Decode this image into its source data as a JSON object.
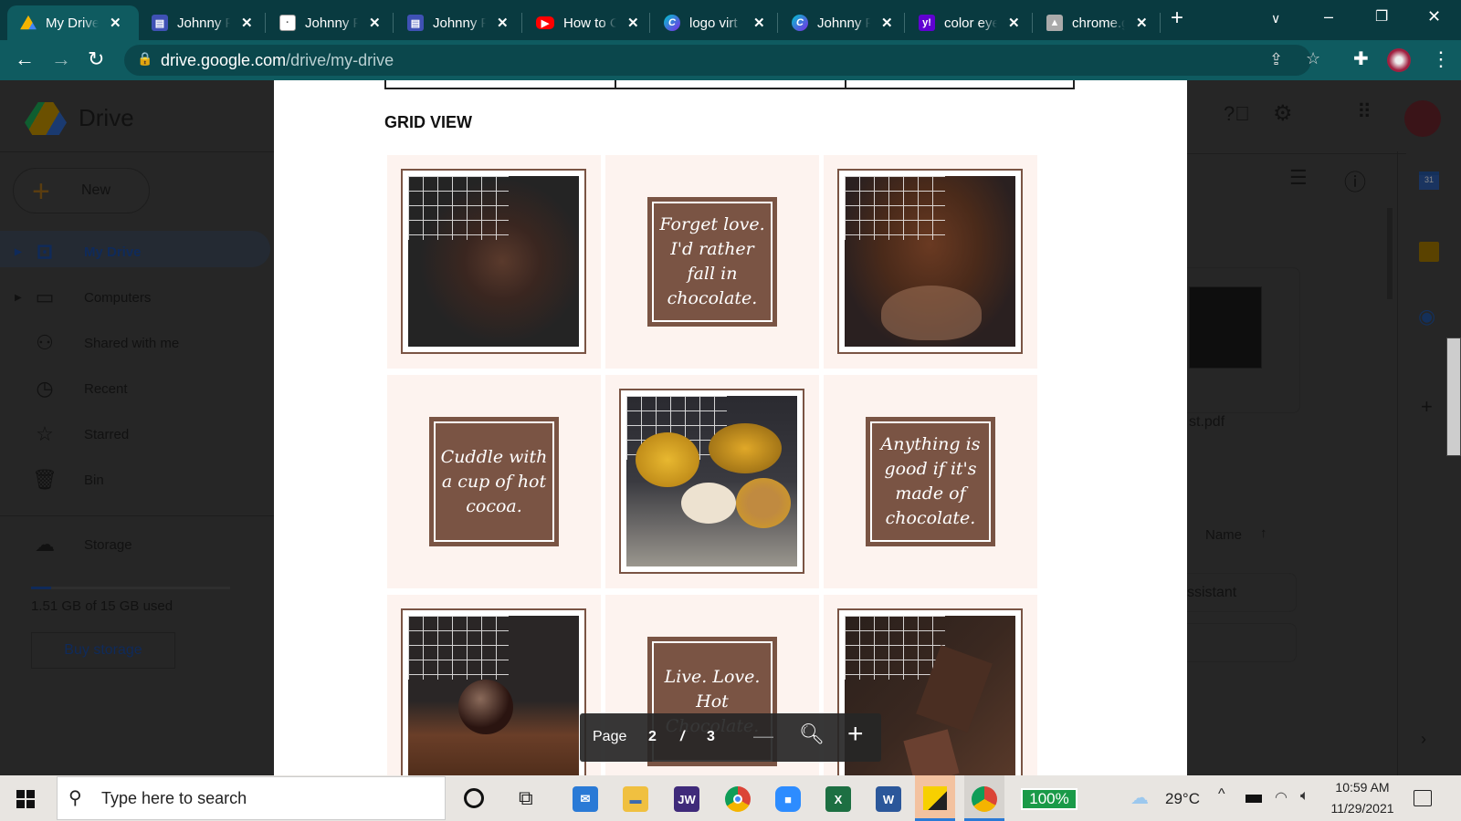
{
  "browser": {
    "tabs": [
      {
        "title": "My Drive",
        "active": true,
        "icon": "drive-icon"
      },
      {
        "title": "Johnny P",
        "icon": "docs-template-icon"
      },
      {
        "title": "Johnny P",
        "icon": "document-thumb-icon"
      },
      {
        "title": "Johnny P",
        "icon": "docs-template-icon"
      },
      {
        "title": "How to C",
        "icon": "youtube-icon"
      },
      {
        "title": "logo virt",
        "icon": "canva-icon"
      },
      {
        "title": "Johnny P",
        "icon": "canva-icon"
      },
      {
        "title": "color eye",
        "icon": "yahoo-icon"
      },
      {
        "title": "chrome.g",
        "icon": "chrome-store-icon"
      }
    ],
    "close_glyph": "✕",
    "url_host": "drive.google.com",
    "url_path": "/drive/my-drive"
  },
  "drive": {
    "logo_text": "Drive",
    "new_label": "New",
    "nav": [
      {
        "label": "My Drive",
        "icon": "my-drive-icon"
      },
      {
        "label": "Computers",
        "icon": "computers-icon"
      },
      {
        "label": "Shared with me",
        "icon": "shared-icon"
      },
      {
        "label": "Recent",
        "icon": "clock-icon"
      },
      {
        "label": "Starred",
        "icon": "star-icon"
      },
      {
        "label": "Bin",
        "icon": "trash-icon"
      }
    ],
    "storage_label": "Storage",
    "storage_used_fraction": 0.1,
    "storage_text": "1.51 GB of 15 GB used",
    "buy_storage": "Buy storage",
    "file_name_partial": "st.pdf",
    "sort_label": "Name",
    "list_item_partial": "ssistant"
  },
  "viewer": {
    "section_title": "GRID VIEW",
    "quotes": [
      "Forget love. I'd rather fall in chocolate.",
      "Cuddle with a cup of hot cocoa.",
      "Anything is good if it's made of chocolate.",
      "Live. Love. Hot Chocolate."
    ],
    "page_label": "Page",
    "current_page": "2",
    "page_sep": "/",
    "total_pages": "3"
  },
  "taskbar": {
    "search_placeholder": "Type here to search",
    "battery": "100%",
    "temperature": "29°C",
    "time": "10:59 AM",
    "date": "11/29/2021",
    "jw_label": "JW"
  }
}
